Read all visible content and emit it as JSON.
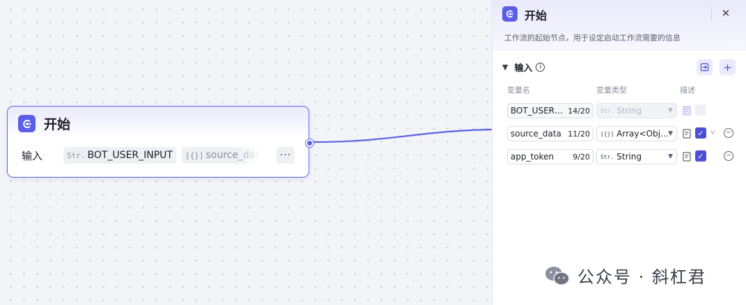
{
  "node": {
    "title": "开始",
    "input_label": "输入",
    "tags": [
      {
        "type_icon": "Str.",
        "name": "BOT_USER_INPUT"
      },
      {
        "type_icon": "[{}]",
        "name": "source_data"
      }
    ],
    "more_label": "···"
  },
  "panel": {
    "title": "开始",
    "description": "工作流的起始节点，用于设定启动工作流需要的信息",
    "section_title": "输入",
    "columns": {
      "name": "变量名",
      "type": "变量类型",
      "desc": "描述"
    },
    "rows": [
      {
        "name": "BOT_USER…",
        "count": "14/20",
        "type_icon": "Str.",
        "type": "String",
        "disabled": true
      },
      {
        "name": "source_data",
        "count": "11/20",
        "type_icon": "[{}]",
        "type": "Array<Obj…",
        "disabled": false
      },
      {
        "name": "app_token",
        "count": "9/20",
        "type_icon": "Str.",
        "type": "String",
        "disabled": false
      }
    ]
  },
  "watermark": {
    "text": "公众号 · 斜杠君"
  },
  "colors": {
    "accent": "#5b5fe6",
    "check": "#4b50d6"
  },
  "icons": [
    "start-logo-icon",
    "close-icon",
    "chevron-down-icon",
    "info-icon",
    "import-icon",
    "plus-icon",
    "document-icon",
    "check-icon",
    "branch-icon",
    "minus-circle-icon",
    "wechat-icon"
  ]
}
